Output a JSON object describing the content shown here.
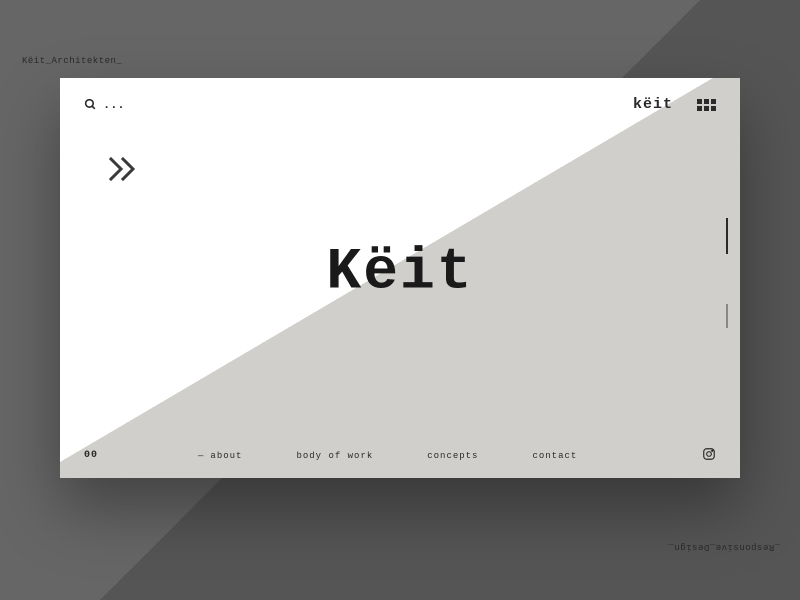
{
  "background": {
    "left_label": "Këit_Architekten_",
    "right_label": "_Responsive_Design_"
  },
  "topbar": {
    "search_placeholder": "...",
    "wordmark": "këit"
  },
  "hero": {
    "title": "Këit"
  },
  "bottombar": {
    "page_num": "00",
    "nav": [
      {
        "prefix": "—",
        "label": "about"
      },
      {
        "prefix": "",
        "label": "body of work"
      },
      {
        "prefix": "",
        "label": "concepts"
      },
      {
        "prefix": "",
        "label": "contact"
      }
    ]
  }
}
